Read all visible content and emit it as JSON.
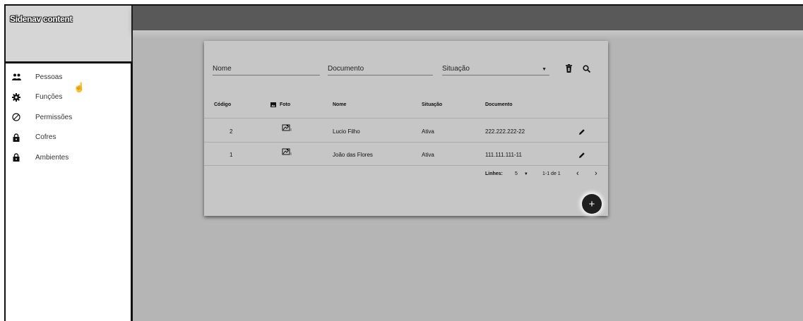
{
  "sidenav": {
    "title": "Sidenav content",
    "items": [
      {
        "label": "Pessoas",
        "icon": "people-icon"
      },
      {
        "label": "Funções",
        "icon": "gear-icon"
      },
      {
        "label": "Permissões",
        "icon": "block-icon"
      },
      {
        "label": "Cofres",
        "icon": "lock-icon"
      },
      {
        "label": "Ambientes",
        "icon": "lock-icon"
      }
    ]
  },
  "filters": {
    "nome": "Nome",
    "documento": "Documento",
    "situacao": "Situação"
  },
  "table": {
    "headers": {
      "codigo": "Código",
      "foto": "Foto",
      "nome": "Nome",
      "situacao": "Situação",
      "documento": "Documento"
    },
    "rows": [
      {
        "codigo": "2",
        "nome": "Lucio Filho",
        "situacao": "Ativa",
        "documento": "222.222.222-22"
      },
      {
        "codigo": "1",
        "nome": "João das Flores",
        "situacao": "Ativa",
        "documento": "111.111.111-11"
      }
    ]
  },
  "paginator": {
    "rows_label": "Linhes:",
    "page_size": "5",
    "range": "1-1 de 1"
  },
  "fab_label": "+"
}
